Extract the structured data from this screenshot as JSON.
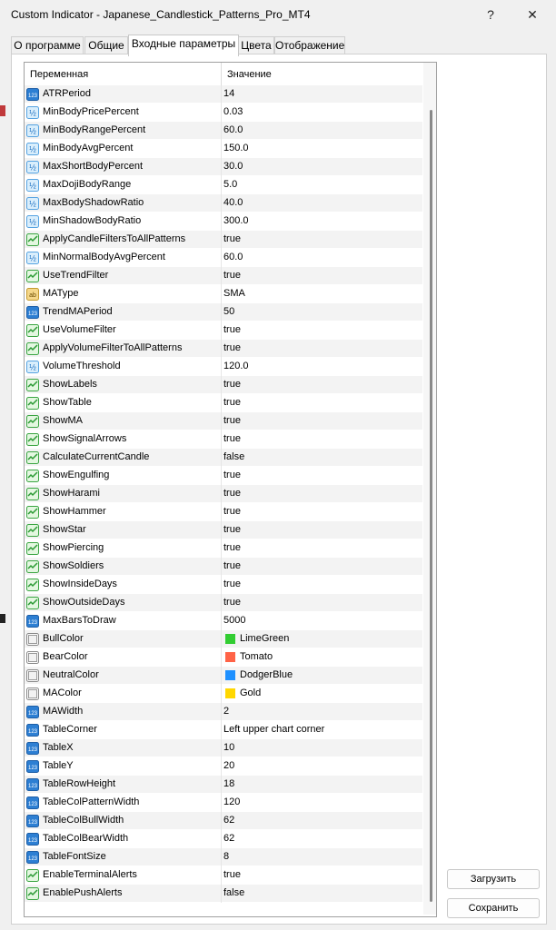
{
  "window": {
    "title": "Custom Indicator - Japanese_Candlestick_Patterns_Pro_MT4",
    "help_label": "?",
    "close_label": "✕"
  },
  "tabs": [
    {
      "label": "О программе",
      "active": false
    },
    {
      "label": "Общие",
      "active": false
    },
    {
      "label": "Входные параметры",
      "active": true
    },
    {
      "label": "Цвета",
      "active": false
    },
    {
      "label": "Отображение",
      "active": false
    }
  ],
  "grid": {
    "col_variable": "Переменная",
    "col_value": "Значение",
    "rows": [
      {
        "icon": "int",
        "name": "ATRPeriod",
        "value": "14"
      },
      {
        "icon": "double",
        "name": "MinBodyPricePercent",
        "value": "0.03"
      },
      {
        "icon": "double",
        "name": "MinBodyRangePercent",
        "value": "60.0"
      },
      {
        "icon": "double",
        "name": "MinBodyAvgPercent",
        "value": "150.0"
      },
      {
        "icon": "double",
        "name": "MaxShortBodyPercent",
        "value": "30.0"
      },
      {
        "icon": "double",
        "name": "MaxDojiBodyRange",
        "value": "5.0"
      },
      {
        "icon": "double",
        "name": "MaxBodyShadowRatio",
        "value": "40.0"
      },
      {
        "icon": "double",
        "name": "MinShadowBodyRatio",
        "value": "300.0"
      },
      {
        "icon": "bool",
        "name": "ApplyCandleFiltersToAllPatterns",
        "value": "true"
      },
      {
        "icon": "double",
        "name": "MinNormalBodyAvgPercent",
        "value": "60.0"
      },
      {
        "icon": "bool",
        "name": "UseTrendFilter",
        "value": "true"
      },
      {
        "icon": "enum",
        "name": "MAType",
        "value": "SMA"
      },
      {
        "icon": "int",
        "name": "TrendMAPeriod",
        "value": "50"
      },
      {
        "icon": "bool",
        "name": "UseVolumeFilter",
        "value": "true"
      },
      {
        "icon": "bool",
        "name": "ApplyVolumeFilterToAllPatterns",
        "value": "true"
      },
      {
        "icon": "double",
        "name": "VolumeThreshold",
        "value": "120.0"
      },
      {
        "icon": "bool",
        "name": "ShowLabels",
        "value": "true"
      },
      {
        "icon": "bool",
        "name": "ShowTable",
        "value": "true"
      },
      {
        "icon": "bool",
        "name": "ShowMA",
        "value": "true"
      },
      {
        "icon": "bool",
        "name": "ShowSignalArrows",
        "value": "true"
      },
      {
        "icon": "bool",
        "name": "CalculateCurrentCandle",
        "value": "false"
      },
      {
        "icon": "bool",
        "name": "ShowEngulfing",
        "value": "true"
      },
      {
        "icon": "bool",
        "name": "ShowHarami",
        "value": "true"
      },
      {
        "icon": "bool",
        "name": "ShowHammer",
        "value": "true"
      },
      {
        "icon": "bool",
        "name": "ShowStar",
        "value": "true"
      },
      {
        "icon": "bool",
        "name": "ShowPiercing",
        "value": "true"
      },
      {
        "icon": "bool",
        "name": "ShowSoldiers",
        "value": "true"
      },
      {
        "icon": "bool",
        "name": "ShowInsideDays",
        "value": "true"
      },
      {
        "icon": "bool",
        "name": "ShowOutsideDays",
        "value": "true"
      },
      {
        "icon": "int",
        "name": "MaxBarsToDraw",
        "value": "5000"
      },
      {
        "icon": "color",
        "name": "BullColor",
        "value": "LimeGreen",
        "swatch": "#32cd32"
      },
      {
        "icon": "color",
        "name": "BearColor",
        "value": "Tomato",
        "swatch": "#ff6347"
      },
      {
        "icon": "color",
        "name": "NeutralColor",
        "value": "DodgerBlue",
        "swatch": "#1e90ff"
      },
      {
        "icon": "color",
        "name": "MAColor",
        "value": "Gold",
        "swatch": "#ffd700"
      },
      {
        "icon": "int",
        "name": "MAWidth",
        "value": "2"
      },
      {
        "icon": "int",
        "name": "TableCorner",
        "value": "Left upper chart corner"
      },
      {
        "icon": "int",
        "name": "TableX",
        "value": "10"
      },
      {
        "icon": "int",
        "name": "TableY",
        "value": "20"
      },
      {
        "icon": "int",
        "name": "TableRowHeight",
        "value": "18"
      },
      {
        "icon": "int",
        "name": "TableColPatternWidth",
        "value": "120"
      },
      {
        "icon": "int",
        "name": "TableColBullWidth",
        "value": "62"
      },
      {
        "icon": "int",
        "name": "TableColBearWidth",
        "value": "62"
      },
      {
        "icon": "int",
        "name": "TableFontSize",
        "value": "8"
      },
      {
        "icon": "bool",
        "name": "EnableTerminalAlerts",
        "value": "true"
      },
      {
        "icon": "bool",
        "name": "EnablePushAlerts",
        "value": "false"
      }
    ]
  },
  "buttons": {
    "load_label": "Загрузить",
    "save_label": "Сохранить"
  },
  "icon_labels": {
    "int": "123",
    "double": "½",
    "enum": "ab"
  }
}
